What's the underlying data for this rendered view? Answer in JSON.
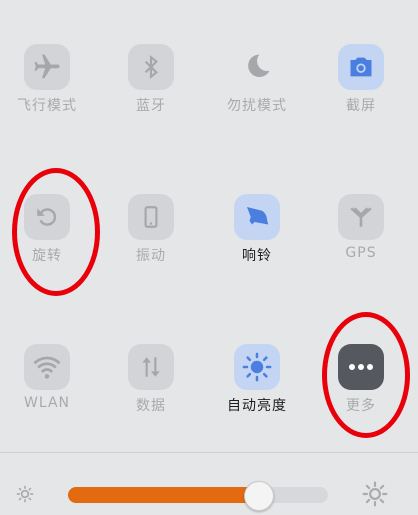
{
  "toggles": [
    {
      "id": "airplane",
      "label": "飞行模式",
      "icon": "airplane-icon",
      "state": "off"
    },
    {
      "id": "bluetooth",
      "label": "蓝牙",
      "icon": "bluetooth-icon",
      "state": "off"
    },
    {
      "id": "dnd",
      "label": "勿扰模式",
      "icon": "moon-icon",
      "state": "off"
    },
    {
      "id": "screenshot",
      "label": "截屏",
      "icon": "camera-icon",
      "state": "on"
    },
    {
      "id": "rotate",
      "label": "旋转",
      "icon": "rotate-icon",
      "state": "off"
    },
    {
      "id": "vibrate",
      "label": "振动",
      "icon": "vibrate-icon",
      "state": "off"
    },
    {
      "id": "ring",
      "label": "响铃",
      "icon": "bell-icon",
      "state": "on"
    },
    {
      "id": "gps",
      "label": "GPS",
      "icon": "gps-antenna-icon",
      "state": "off"
    },
    {
      "id": "wlan",
      "label": "WLAN",
      "icon": "wifi-icon",
      "state": "off"
    },
    {
      "id": "data",
      "label": "数据",
      "icon": "data-arrows-icon",
      "state": "off"
    },
    {
      "id": "auto-brightness",
      "label": "自动亮度",
      "icon": "sun-icon",
      "state": "on"
    },
    {
      "id": "more",
      "label": "更多",
      "icon": "more-icon",
      "state": "off"
    }
  ],
  "brightness": {
    "level": 0.73,
    "min_icon": "brightness-low-icon",
    "max_icon": "brightness-high-icon"
  },
  "colors": {
    "accent_on": "#4a7fe0",
    "slider": "#e26a10",
    "annotation": "#e8000a"
  }
}
